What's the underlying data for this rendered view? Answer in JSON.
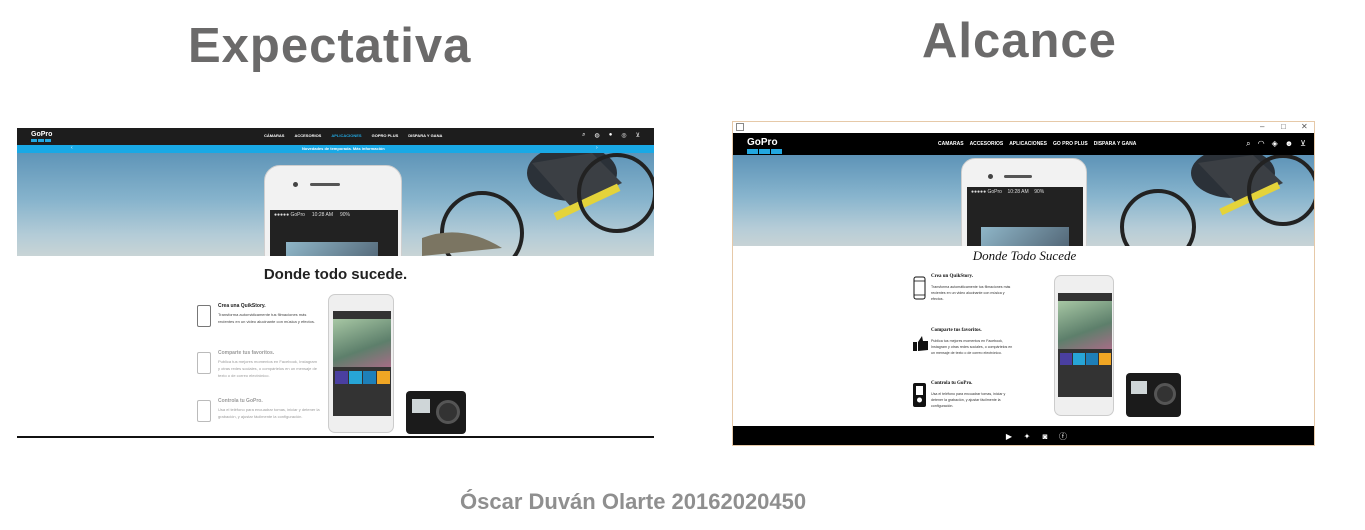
{
  "slide": {
    "heading_left": "Expectativa",
    "heading_right": "Alcance",
    "author": "Óscar Duván Olarte 20162020450"
  },
  "left_mock": {
    "logo": "GoPro",
    "menu": [
      "CÁMARAS",
      "ACCESORIOS",
      "APLICACIONES",
      "GOPRO PLUS",
      "DISPARA Y GANA"
    ],
    "active_menu": "APLICACIONES",
    "strip_text": "Novedades de temporada. Más información",
    "phone_status": "●●●●● GoPro",
    "phone_time": "10:28 AM",
    "phone_battery": "90%",
    "title": "Donde todo sucede.",
    "features": [
      {
        "title": "Crea una QuikStory.",
        "desc": "Transforma automáticamente tus filmaciones más recientes en un video alucinante con música y efectos."
      },
      {
        "title": "Comparte tus favoritos.",
        "desc": "Publica tus mejores momentos en Facebook, Instagram y otras redes sociales, o compártelos en un mensaje de texto o de correo electrónico."
      },
      {
        "title": "Controla tu GoPro.",
        "desc": "Usa el teléfono para encuadrar tomas, iniciar y detener la grabación, y ajustar fácilmente la configuración."
      }
    ]
  },
  "right_mock": {
    "logo": "GoPro",
    "menu": [
      "CAMARAS",
      "ACCESORIOS",
      "APLICACIONES",
      "GO PRO PLUS",
      "DISPARA Y GANA"
    ],
    "phone_status": "●●●●● GoPro",
    "phone_time": "10:28 AM",
    "phone_battery": "90%",
    "title": "Donde Todo Sucede",
    "features": [
      {
        "title": "Crea un QuikStory.",
        "desc": "Transforma automáticamente tus filmaciones más recientes en un video alucinante con música y efectos."
      },
      {
        "title": "Comparte tus favoritos.",
        "desc": "Publica tus mejores momentos en Facebook, Instagram y otras redes sociales, o compártelos en un mensaje de texto o de correo electrónico."
      },
      {
        "title": "Controla tu GoPro.",
        "desc": "Usa el teléfono para encuadrar tomas, iniciar y detener la grabación, y ajustar fácilmente la configuración."
      }
    ],
    "social": [
      "youtube-icon",
      "twitter-icon",
      "instagram-icon",
      "facebook-icon"
    ]
  },
  "colors": {
    "gopro_blue": "#22a7e0",
    "strip_blue": "#19a9e6",
    "heading_gray": "#6b6a6a"
  }
}
